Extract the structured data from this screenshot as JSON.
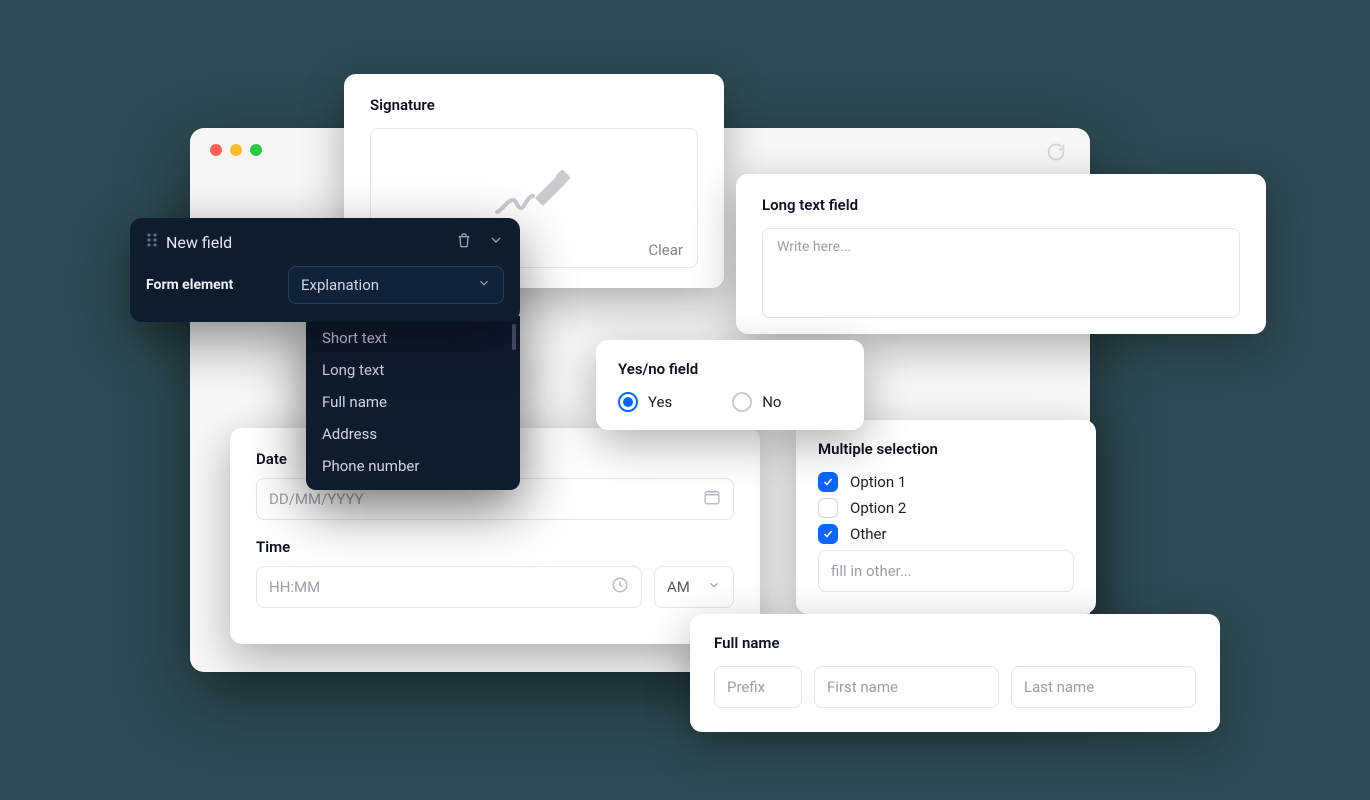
{
  "signature": {
    "title": "Signature",
    "clear": "Clear"
  },
  "new_field": {
    "title": "New field",
    "form_element_label": "Form element",
    "selected": "Explanation",
    "options": [
      "Short text",
      "Long text",
      "Full name",
      "Address",
      "Phone number"
    ]
  },
  "long_text": {
    "title": "Long text field",
    "placeholder": "Write here..."
  },
  "date_time": {
    "date_label": "Date",
    "date_placeholder": "DD/MM/YYYY",
    "time_label": "Time",
    "time_placeholder": "HH:MM",
    "ampm": "AM"
  },
  "yes_no": {
    "title": "Yes/no field",
    "yes": "Yes",
    "no": "No"
  },
  "multi": {
    "title": "Multiple selection",
    "options": [
      {
        "label": "Option 1",
        "checked": true
      },
      {
        "label": "Option 2",
        "checked": false
      },
      {
        "label": "Other",
        "checked": true
      }
    ],
    "other_placeholder": "fill in other..."
  },
  "full_name": {
    "title": "Full name",
    "prefix_ph": "Prefix",
    "first_ph": "First name",
    "last_ph": "Last name"
  }
}
